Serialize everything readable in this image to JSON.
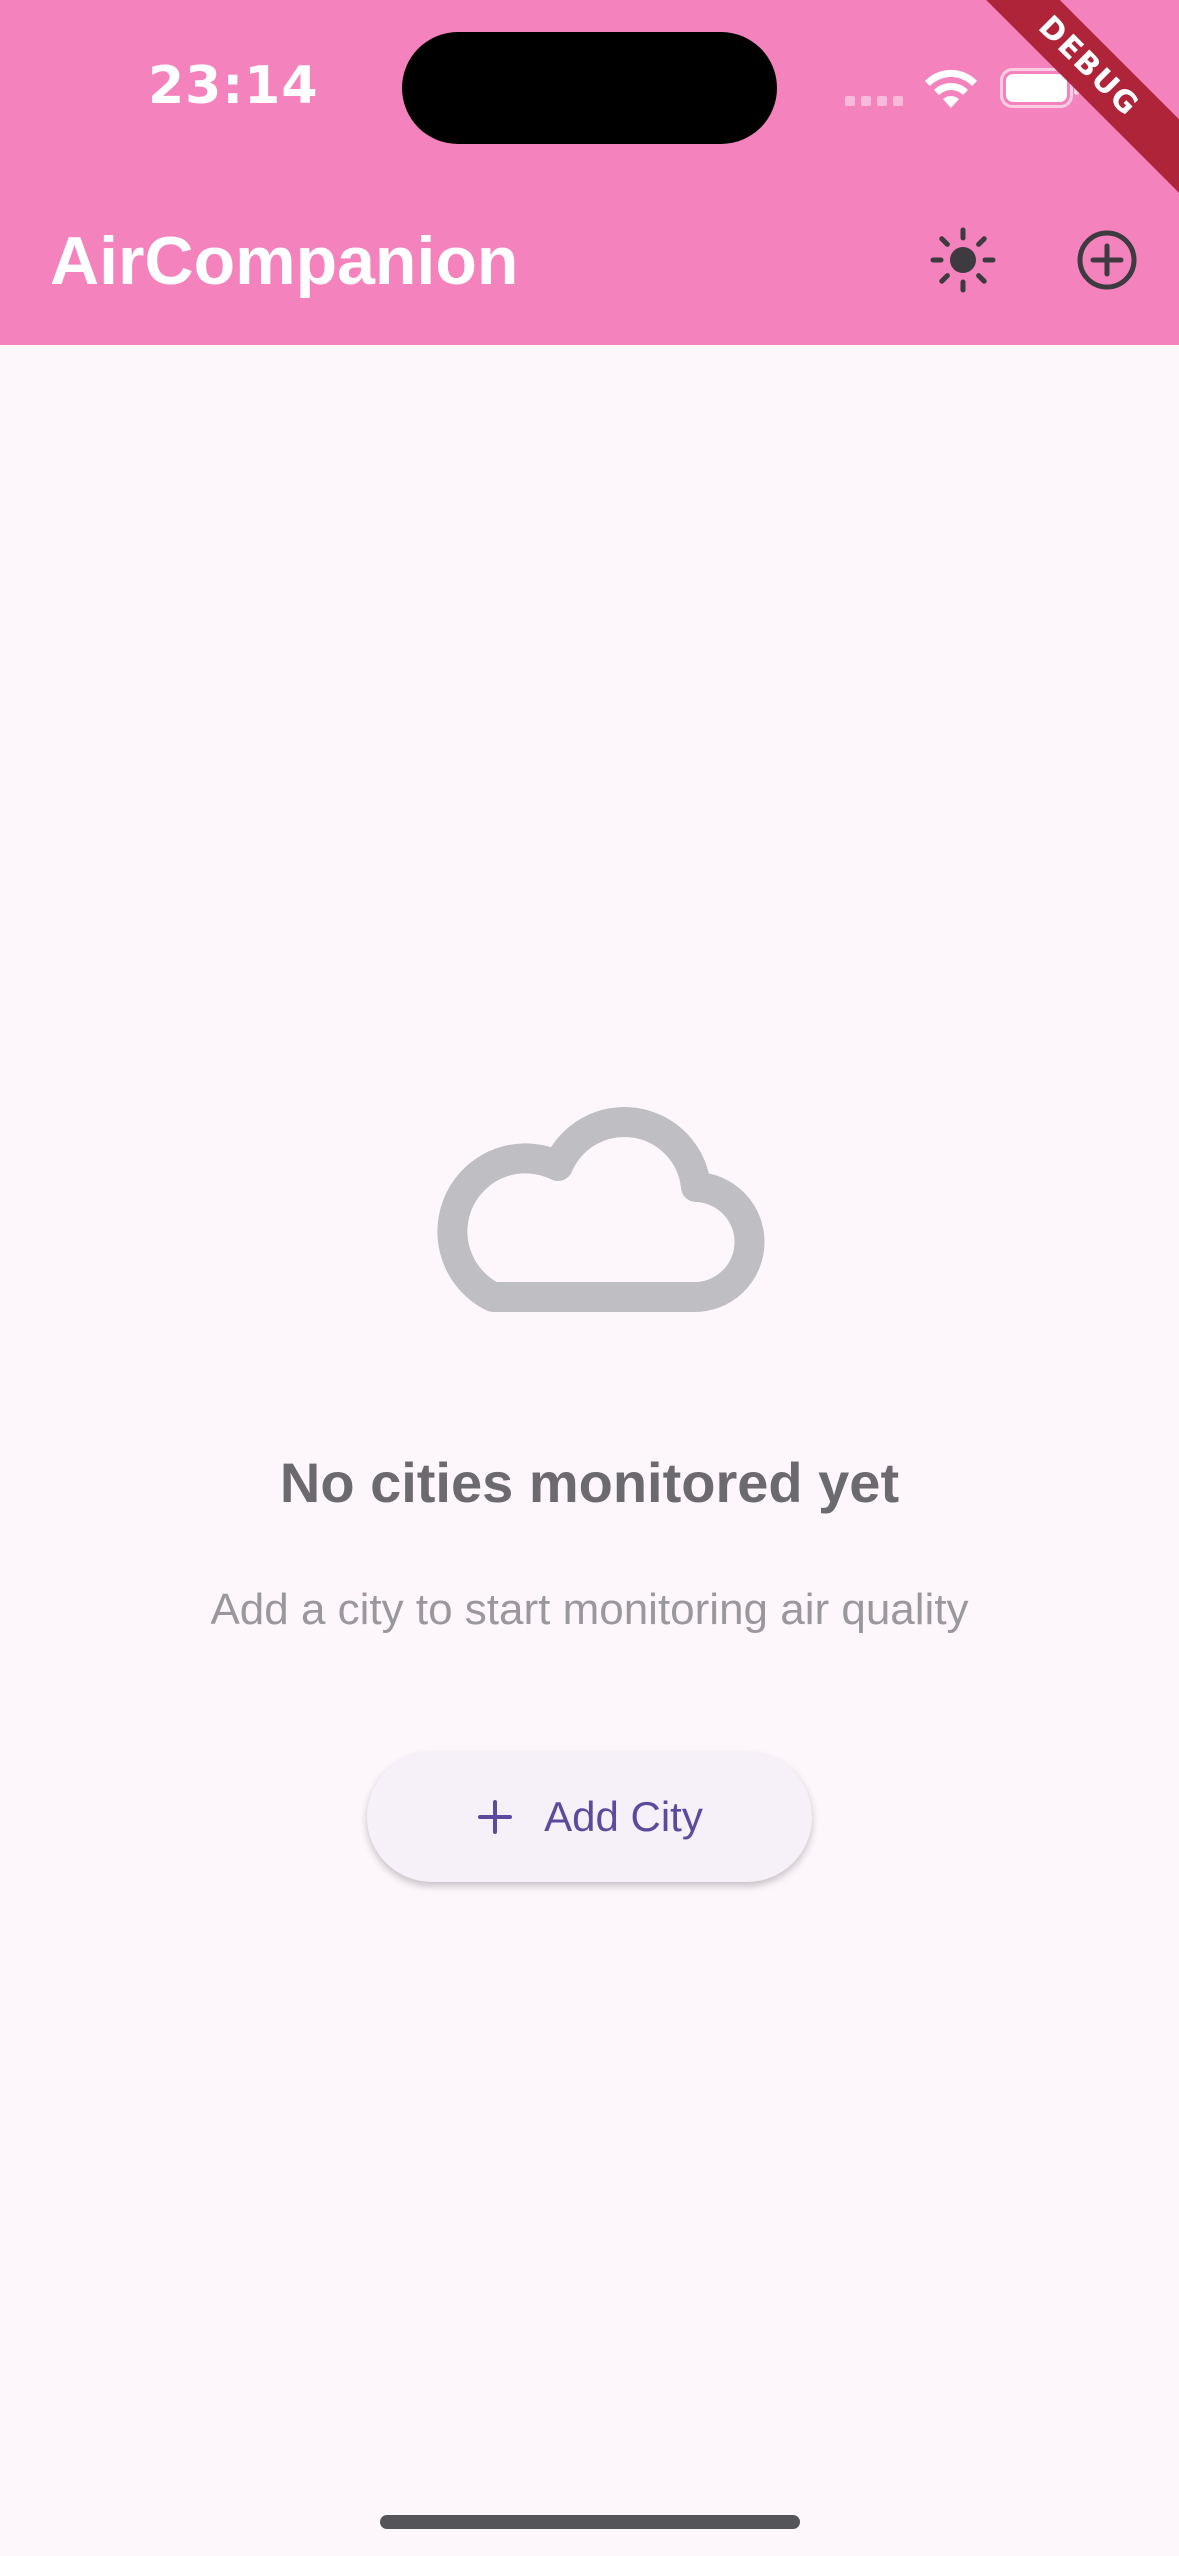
{
  "status_bar": {
    "time": "23:14"
  },
  "app_bar": {
    "title": "AirCompanion",
    "theme_icon": "sun-icon",
    "add_icon": "add-circle-icon",
    "color": "#f382bd"
  },
  "debug_banner": "DEBUG",
  "empty_state": {
    "icon": "cloud-icon",
    "title": "No cities monitored yet",
    "subtitle": "Add a city to start monitoring air quality",
    "button_label": "Add City",
    "button_icon": "plus-icon"
  },
  "colors": {
    "accent": "#5b4a9e",
    "background": "#fdf7fc"
  }
}
